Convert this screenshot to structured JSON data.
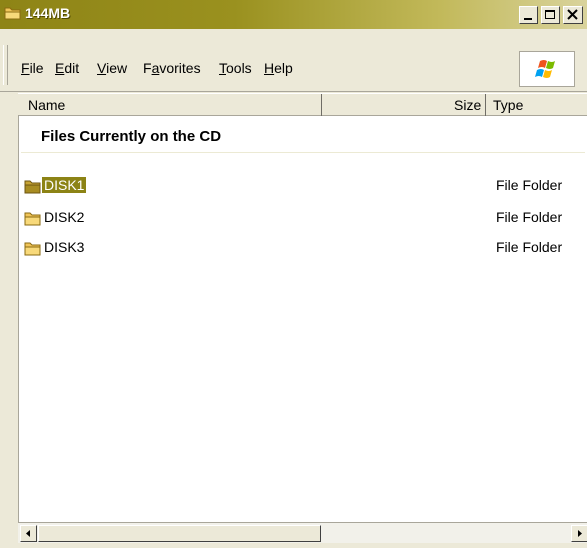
{
  "window": {
    "title": "144MB"
  },
  "menu": [
    "File",
    "Edit",
    "View",
    "Favorites",
    "Tools",
    "Help"
  ],
  "menu_accel": [
    "F",
    "E",
    "V",
    "a",
    "T",
    "H"
  ],
  "columns": {
    "name": "Name",
    "size": "Size",
    "type": "Type"
  },
  "group": {
    "title": "Files Currently on the CD"
  },
  "items": [
    {
      "name": "DISK1",
      "type": "File Folder",
      "selected": true
    },
    {
      "name": "DISK2",
      "type": "File Folder",
      "selected": false
    },
    {
      "name": "DISK3",
      "type": "File Folder",
      "selected": false
    }
  ],
  "colors": {
    "titlebar": "#8e8416",
    "selection": "#8c8315",
    "folder": "#f1c55a"
  }
}
